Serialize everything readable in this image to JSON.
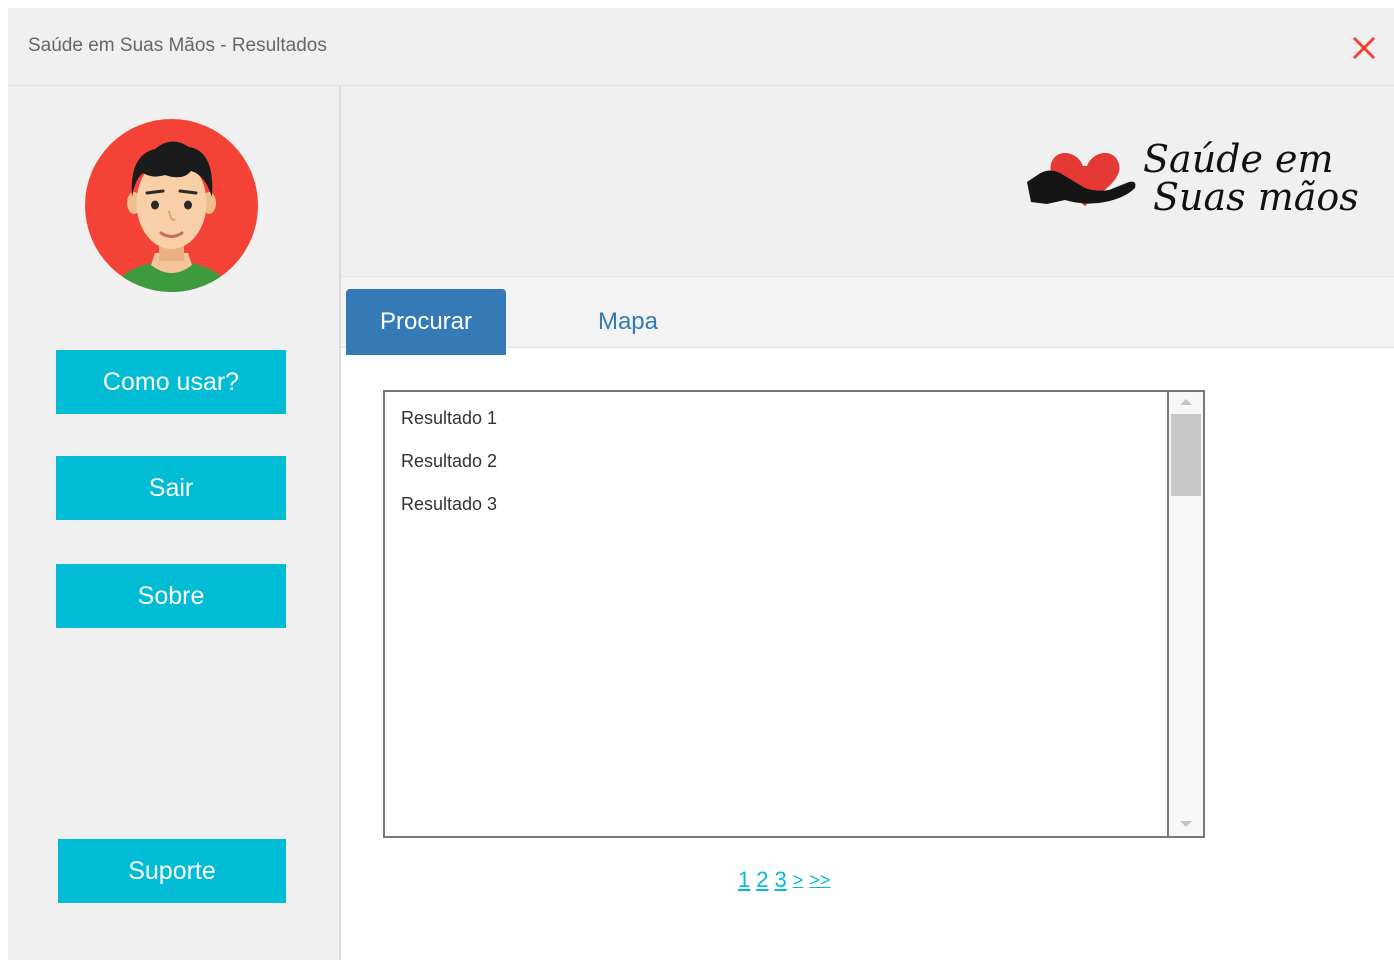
{
  "window": {
    "title": "Saúde em Suas Mãos - Resultados",
    "close_icon": "close-icon",
    "close_color": "#f44336"
  },
  "sidebar": {
    "avatar_icon": "user-avatar",
    "buttons": [
      {
        "label": "Como usar?"
      },
      {
        "label": "Sair"
      },
      {
        "label": "Sobre"
      },
      {
        "label": "Suporte"
      }
    ],
    "button_color": "#00bcd4"
  },
  "header": {
    "logo": {
      "line1": "Saúde em",
      "line2": "Suas mãos",
      "icon": "heart-in-hand-icon",
      "heart_color": "#e53935"
    }
  },
  "tabs": [
    {
      "label": "Procurar",
      "active": true
    },
    {
      "label": "Mapa",
      "active": false
    }
  ],
  "results": {
    "items": [
      "Resultado 1",
      "Resultado 2",
      "Resultado 3"
    ]
  },
  "pagination": {
    "pages": [
      "1",
      "2",
      "3"
    ],
    "next": ">",
    "last": ">>"
  },
  "colors": {
    "tab_active": "#337ab7",
    "link": "#00bcd4"
  }
}
